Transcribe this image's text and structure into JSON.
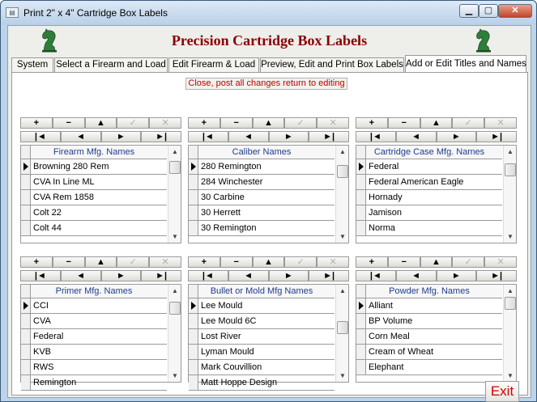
{
  "window": {
    "title": "Print 2\" x 4\" Cartridge Box Labels",
    "controls": {
      "minimize": "▁",
      "maximize": "▢",
      "close": "✕"
    }
  },
  "header": {
    "title": "Precision Cartridge Box Labels"
  },
  "tabs": [
    {
      "label": "System",
      "active": false
    },
    {
      "label": "Select a Firearm and Load",
      "active": false
    },
    {
      "label": "Edit Firearm & Load",
      "active": false
    },
    {
      "label": "Preview, Edit and Print Box Labels",
      "active": false
    },
    {
      "label": "Add or Edit Titles and Names",
      "active": true
    }
  ],
  "close_post_label": "Close, post all changes return to editing",
  "toolbar": {
    "add": "+",
    "delete": "−",
    "up": "▲",
    "post": "✓",
    "cancel": "✕",
    "first": "|◄",
    "prev": "◄",
    "next": "►",
    "last": "►|"
  },
  "lists": [
    {
      "header": "Firearm Mfg. Names",
      "items": [
        "Browning 280 Rem",
        "CVA In Line ML",
        "CVA Rem 1858",
        "Colt 22",
        "Colt 44"
      ],
      "scroll_position": 0.05
    },
    {
      "header": "Caliber Names",
      "items": [
        "280 Remington",
        "284 Winchester",
        "30 Carbine",
        "30 Herrett",
        "30 Remington"
      ],
      "scroll_position": 0.12
    },
    {
      "header": "Cartridge Case Mfg. Names",
      "items": [
        "Federal",
        "Federal American Eagle",
        "Hornady",
        "Jamison",
        "Norma"
      ],
      "scroll_position": 0.1
    },
    {
      "header": "Primer Mfg. Names",
      "items": [
        "CCI",
        "CVA",
        "Federal",
        "KVB",
        "RWS",
        "Remington"
      ],
      "scroll_position": 0.08
    },
    {
      "header": "Bullet or Mold Mfg Names",
      "items": [
        "Lee Mould",
        "Lee Mould 6C",
        "Lost River",
        "Lyman Mould",
        "Mark Couvillion",
        "Matt Hoppe Design"
      ],
      "scroll_position": 0.4
    },
    {
      "header": "Powder Mfg. Names",
      "items": [
        "Alliant",
        "BP Volume",
        "Corn Meal",
        "Cream of Wheat",
        "Elephant"
      ],
      "scroll_position": 0.0
    }
  ],
  "exit_label": "Exit",
  "colors": {
    "title": "#8b0000",
    "list_header_text": "#1f3c8c",
    "close_post_text": "#c00000",
    "exit_text": "#d00000"
  }
}
